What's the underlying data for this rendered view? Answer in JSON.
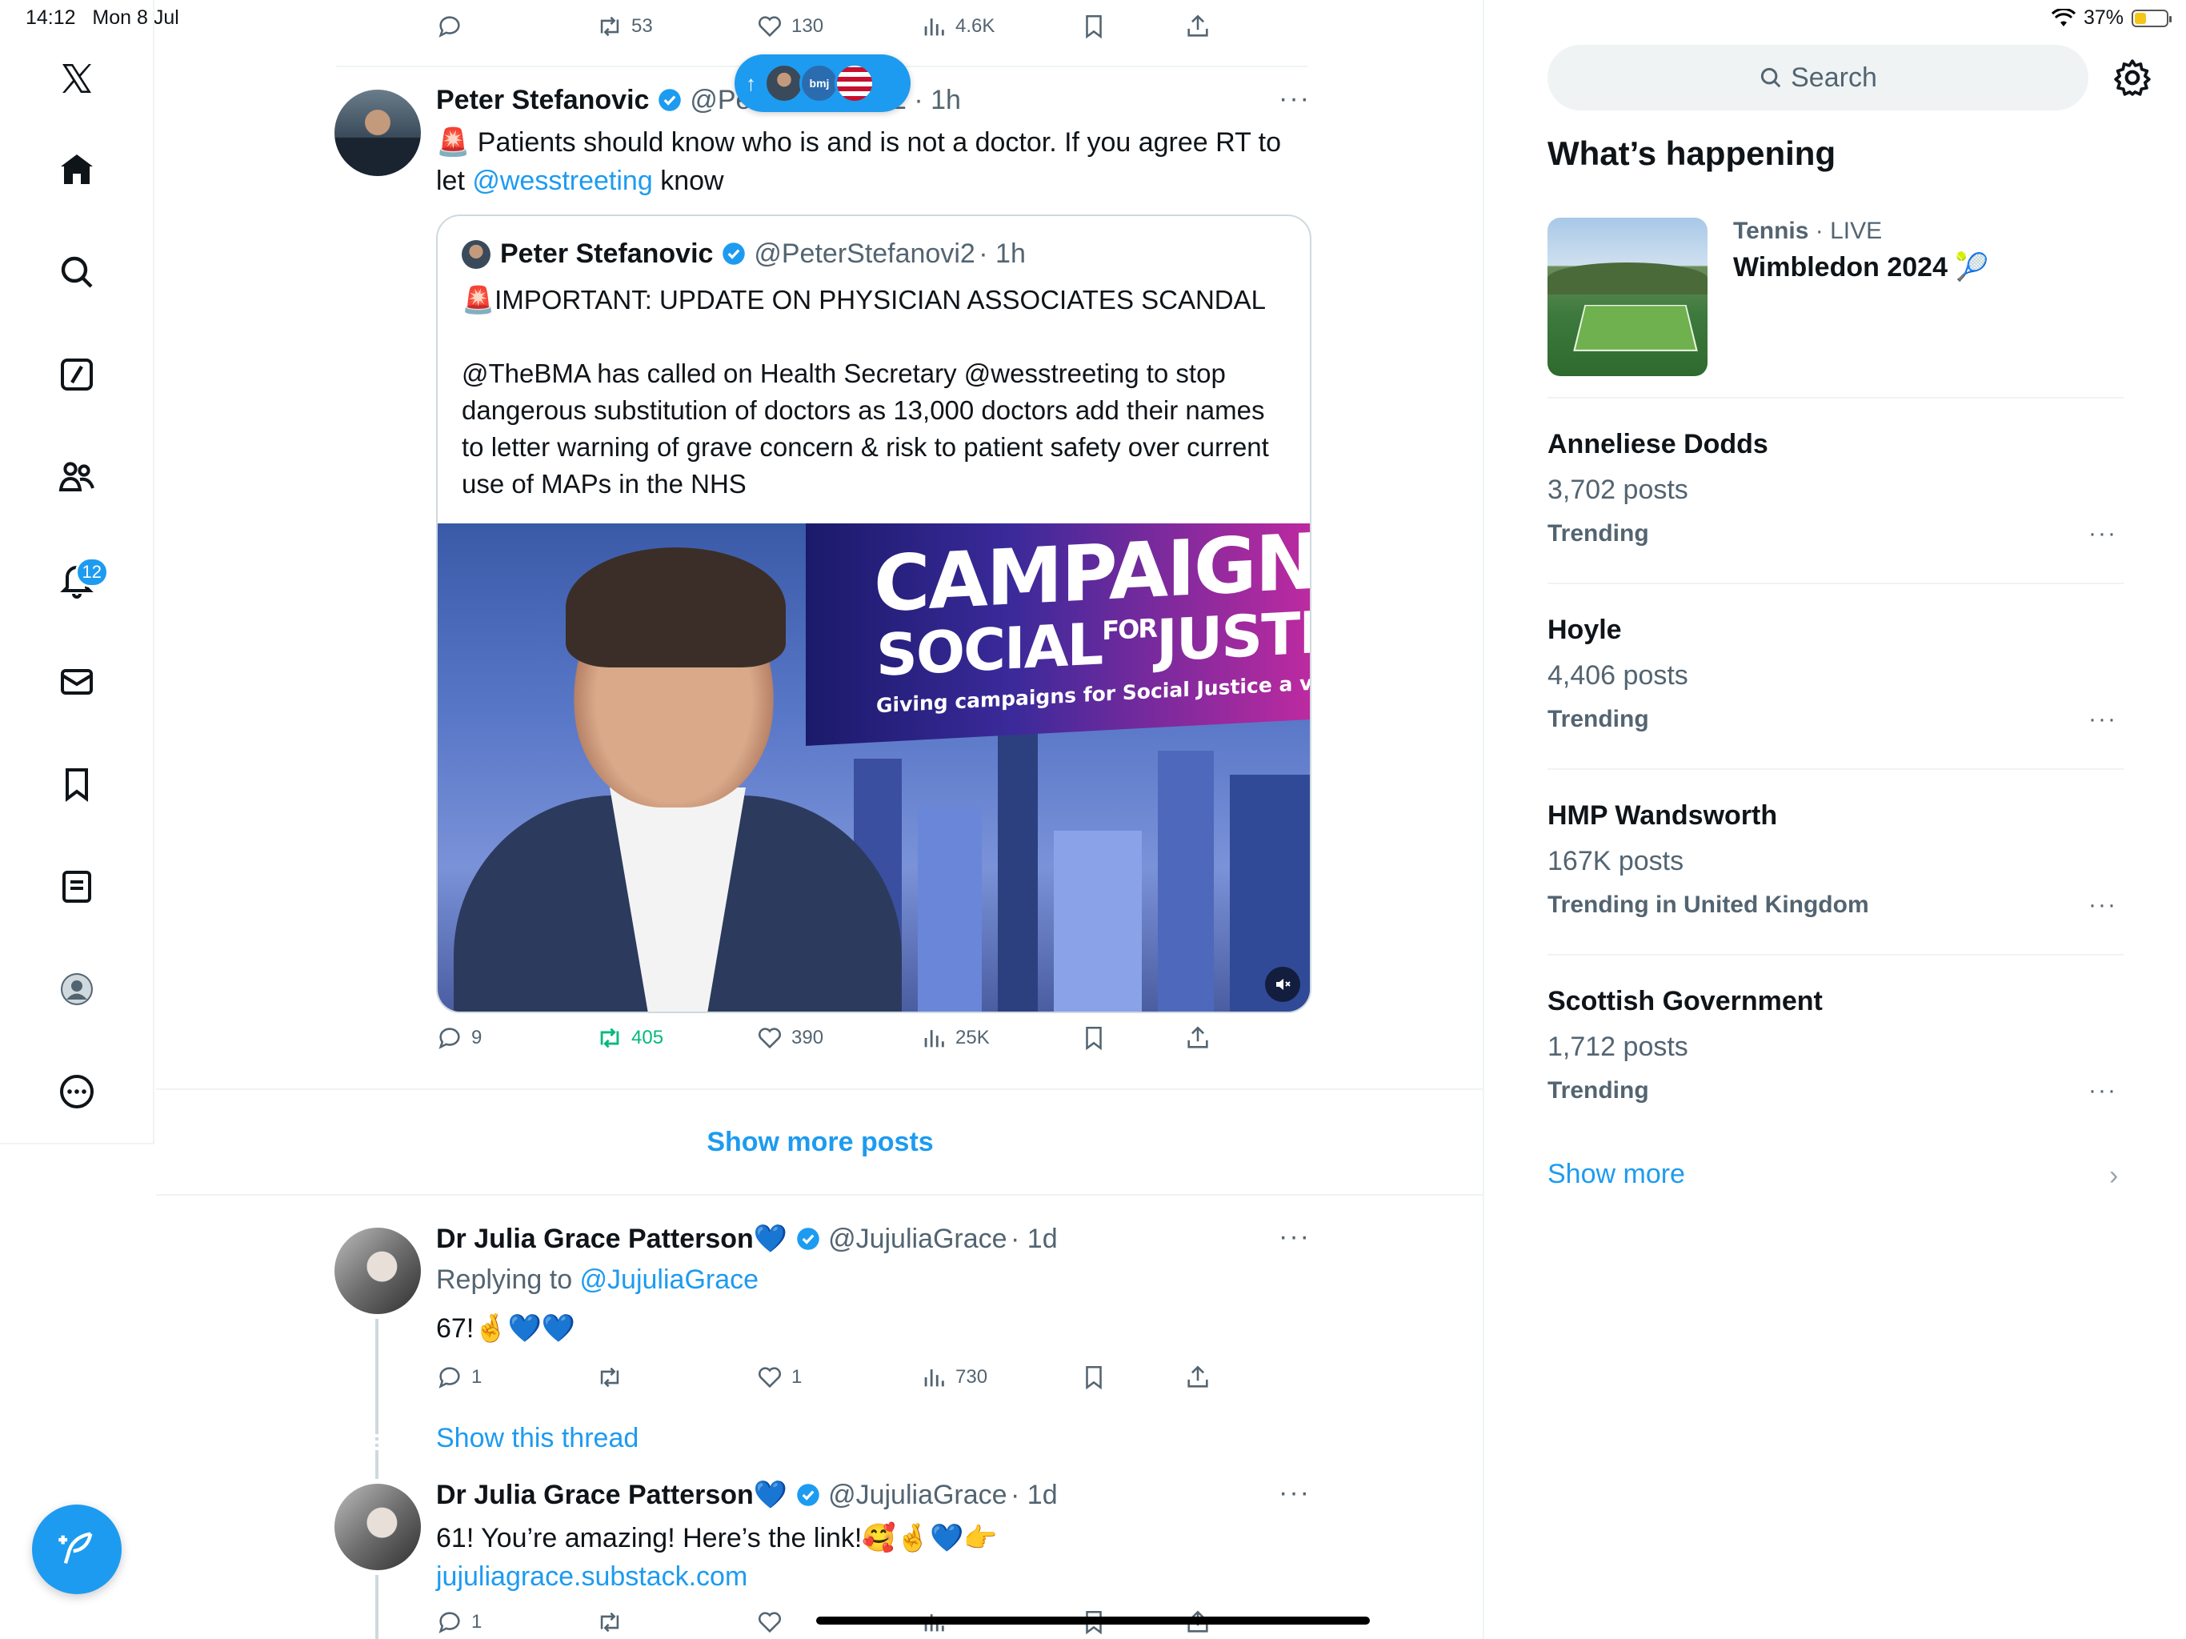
{
  "status_bar": {
    "time": "14:12",
    "date": "Mon 8 Jul",
    "battery": "37%"
  },
  "left_nav": {
    "items": [
      {
        "name": "logo",
        "icon": "x-logo-icon"
      },
      {
        "name": "home",
        "icon": "home-icon"
      },
      {
        "name": "explore",
        "icon": "search-icon"
      },
      {
        "name": "grok",
        "icon": "slash-square-icon"
      },
      {
        "name": "communities",
        "icon": "people-icon"
      },
      {
        "name": "notifications",
        "icon": "bell-icon",
        "badge": "12"
      },
      {
        "name": "messages",
        "icon": "mail-icon"
      },
      {
        "name": "bookmarks",
        "icon": "bookmark-icon"
      },
      {
        "name": "lists",
        "icon": "list-icon"
      },
      {
        "name": "profile",
        "icon": "profile-icon"
      },
      {
        "name": "more",
        "icon": "more-circle-icon"
      }
    ],
    "compose_icon": "compose-feather-icon"
  },
  "top_partial_actions": {
    "replies": "",
    "reposts": "53",
    "likes": "130",
    "views": "4.6K"
  },
  "scroll_pill": {
    "arrow": "↑",
    "label": "bmj"
  },
  "post1": {
    "name": "Peter Stefanovic",
    "handle": "@Pe",
    "handle_tail": "2",
    "time": "· 1h",
    "emoji": "🚨",
    "text_before": " Patients should know who is and is not a doctor. If you agree RT to let ",
    "mention": "@wesstreeting",
    "text_after": " know",
    "quote": {
      "name": "Peter Stefanovic",
      "handle": "@PeterStefanovi2",
      "time": "· 1h",
      "line1": "🚨IMPORTANT: UPDATE ON PHYSICIAN ASSOCIATES SCANDAL",
      "line2": "@TheBMA has called on Health Secretary @wesstreeting to stop dangerous substitution of doctors as 13,000 doctors add their names to letter warning of grave concern & risk to patient safety over current use of MAPs in the NHS",
      "media": {
        "headline1": "CAMPAIGN",
        "headline2a": "SOCIAL",
        "headline2b": "FOR",
        "headline2c": "JUSTICE",
        "tagline": "Giving campaigns for Social Justice a voic"
      }
    },
    "actions": {
      "replies": "9",
      "reposts": "405",
      "likes": "390",
      "views": "25K"
    }
  },
  "show_more_posts": "Show more posts",
  "post2": {
    "name": "Dr Julia Grace Patterson💙",
    "handle": "@JujuliaGrace",
    "time": "· 1d",
    "replying_to_label": "Replying to ",
    "replying_to": "@JujuliaGrace",
    "text": "67!🤞💙💙",
    "actions": {
      "replies": "1",
      "reposts": "",
      "likes": "1",
      "views": "730"
    }
  },
  "show_thread": "Show this thread",
  "post3": {
    "name": "Dr Julia Grace Patterson💙",
    "handle": "@JujuliaGrace",
    "time": "· 1d",
    "text": "61! You’re amazing! Here’s the link!🥰🤞💙👉",
    "link": "jujuliagrace.substack.com",
    "actions": {
      "replies": "1",
      "reposts": "",
      "likes": "",
      "views": ""
    }
  },
  "sidebar": {
    "search_placeholder": "Search",
    "heading": "What’s happening",
    "featured": {
      "category": "Tennis",
      "live": " · LIVE",
      "title": "Wimbledon 2024 🎾"
    },
    "trends": [
      {
        "title": "Anneliese Dodds",
        "count": "3,702 posts",
        "meta": "Trending"
      },
      {
        "title": "Hoyle",
        "count": "4,406 posts",
        "meta": "Trending"
      },
      {
        "title": "HMP Wandsworth",
        "count": "167K posts",
        "meta": "Trending in United Kingdom"
      },
      {
        "title": "Scottish Government",
        "count": "1,712 posts",
        "meta": "Trending"
      }
    ],
    "show_more": "Show more"
  },
  "colors": {
    "accent": "#1d9bf0",
    "repost_green": "#00ba7c",
    "text": "#0f1419",
    "muted": "#536471"
  }
}
